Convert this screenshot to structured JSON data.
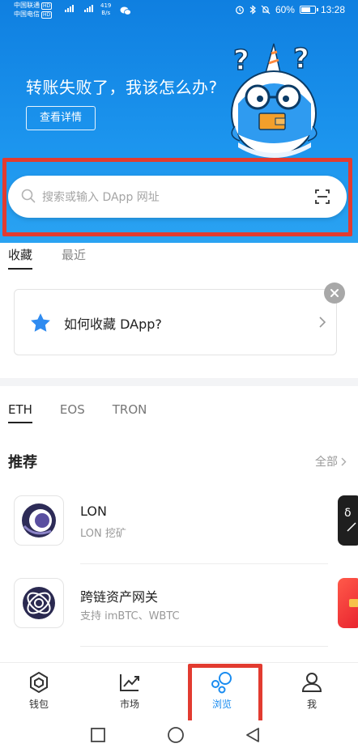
{
  "status_bar": {
    "carrier1": "中国联通",
    "carrier2": "中国电信",
    "hd": "HD",
    "net_speed_value": "419",
    "net_speed_unit": "B/s",
    "battery": "60%",
    "time": "13:28"
  },
  "banner": {
    "title": "转账失败了，我该怎么办?",
    "button_label": "查看详情"
  },
  "search": {
    "placeholder": "搜索或输入 DApp 网址",
    "highlight_color": "#e23b30"
  },
  "fav_tabs": {
    "items": [
      {
        "label": "收藏",
        "active": true
      },
      {
        "label": "最近",
        "active": false
      }
    ]
  },
  "tip_card": {
    "text": "如何收藏 DApp?"
  },
  "chain_tabs": {
    "items": [
      {
        "label": "ETH",
        "active": true
      },
      {
        "label": "EOS",
        "active": false
      },
      {
        "label": "TRON",
        "active": false
      }
    ]
  },
  "recommend": {
    "title": "推荐",
    "see_all": "全部",
    "items": [
      {
        "name": "LON",
        "desc": "LON 挖矿",
        "icon": "lon-logo-icon"
      },
      {
        "name": "跨链资产网关",
        "desc": "支持 imBTC、WBTC",
        "icon": "gateway-logo-icon"
      }
    ]
  },
  "tabbar": {
    "accent": "#1a8cf0",
    "items": [
      {
        "label": "钱包",
        "icon": "wallet-icon",
        "active": false
      },
      {
        "label": "市场",
        "icon": "market-chart-icon",
        "active": false
      },
      {
        "label": "浏览",
        "icon": "browse-bubbles-icon",
        "active": true
      },
      {
        "label": "我",
        "icon": "profile-icon",
        "active": false
      }
    ]
  },
  "colors": {
    "banner_top": "#0f7fe0",
    "banner_bottom": "#2aa3f2",
    "star": "#2f8bf0"
  }
}
